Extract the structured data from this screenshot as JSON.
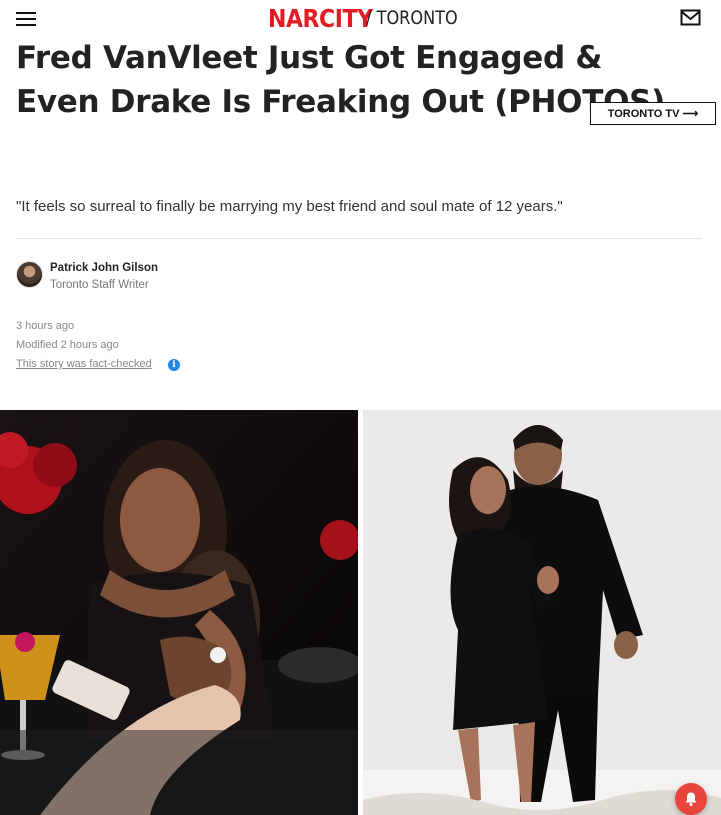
{
  "header": {
    "brand": "NARCITY",
    "city": "/ TORONTO"
  },
  "article": {
    "headline": "Fred VanVleet Just Got Engaged & Even Drake Is Freaking Out (PHOTOS)",
    "tv_button_label": "TORONTO TV ⟶",
    "quote": "\"It feels so surreal to finally be marrying my best friend and soul mate of 12 years.\"",
    "author": {
      "name": "Patrick John Gilson",
      "role": "Toronto Staff Writer"
    },
    "published": "3 hours ago",
    "modified": "Modified 2 hours ago",
    "fact_check_label": "This story was fact-checked"
  },
  "colors": {
    "brand_red": "#e31b23",
    "info_blue": "#1e88e5",
    "bell_red": "#e8453c"
  },
  "icons": {
    "menu": "hamburger-menu-icon",
    "mail": "mail-icon",
    "info": "info-icon",
    "notification": "bell-icon"
  }
}
